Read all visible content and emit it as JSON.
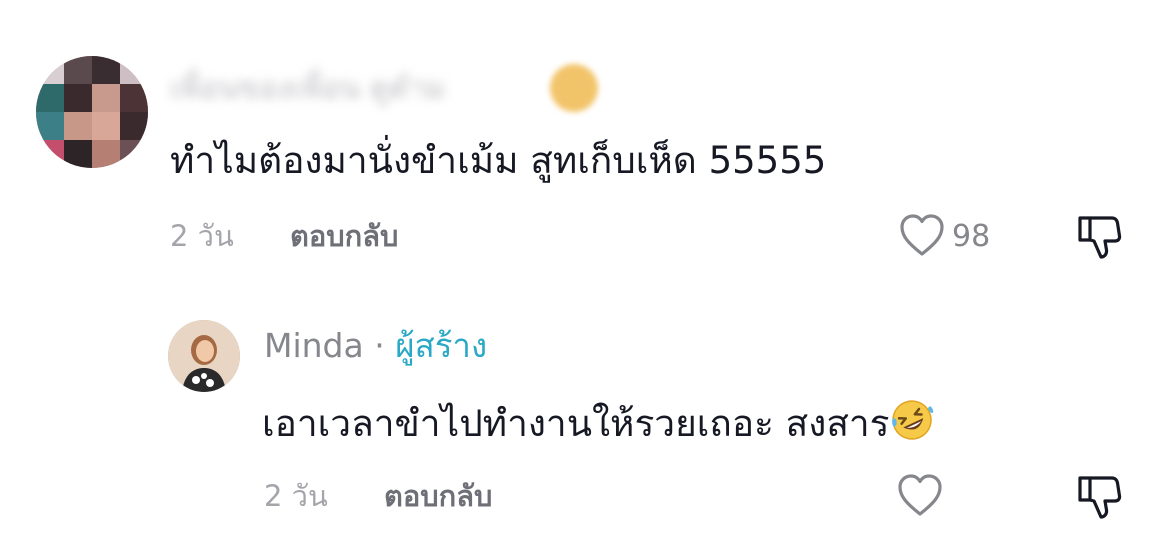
{
  "comments": [
    {
      "username": "เพื่อนของเพื่อน ดูดำม",
      "text": "ทำไมต้องมานั่งขำเม้ม สูทเก็บเห็ด 55555",
      "time": "2 วัน",
      "reply_label": "ตอบกลับ",
      "like_count": "98"
    }
  ],
  "reply": {
    "username": "Minda",
    "separator": "·",
    "creator_label": "ผู้สร้าง",
    "text": "เอาเวลาขำไปทำงานให้รวยเถอะ สงสาร",
    "emoji": "rolling-on-floor-laughing",
    "time": "2 วัน",
    "reply_label": "ตอบกลับ"
  },
  "icons": {
    "like": "heart-outline-icon",
    "dislike": "thumbs-down-icon"
  },
  "colors": {
    "text": "#161823",
    "muted": "#86878c",
    "creator": "#2aa8c6"
  }
}
